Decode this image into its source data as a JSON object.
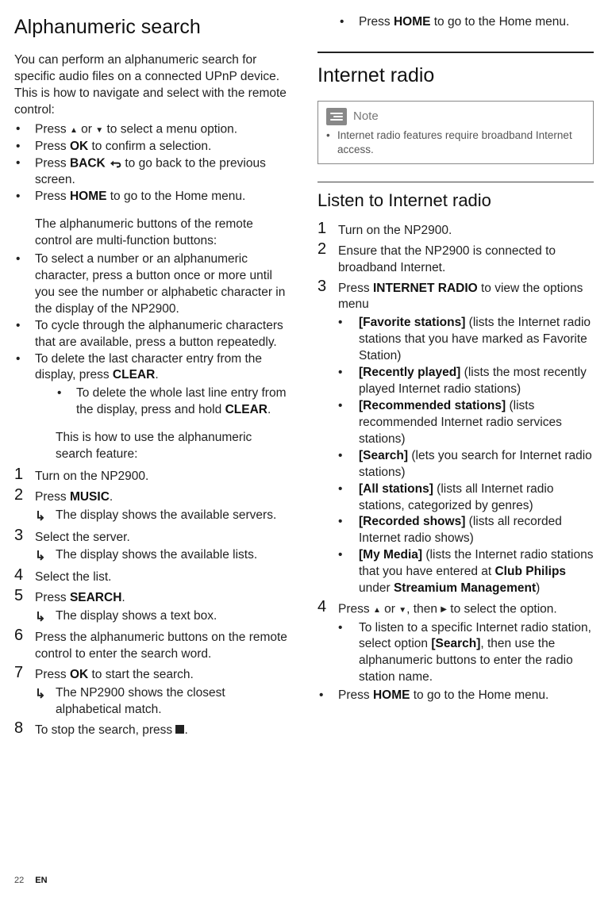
{
  "left": {
    "title": "Alphanumeric search",
    "intro": "You can perform an alphanumeric search for specific audio files on a connected UPnP device. This is how to navigate and select with the remote control:",
    "bullets1": [
      {
        "pre": "Press ",
        "mid1": "",
        "or": " or ",
        "mid2": "",
        "post": " to select a menu option.",
        "hasArrows": true
      },
      {
        "pre": "Press ",
        "bold": "OK",
        "post": " to confirm a selection."
      },
      {
        "pre": "Press ",
        "bold": "BACK",
        "post": " to go back to the previous screen.",
        "hasBackIcon": true
      },
      {
        "pre": "Press ",
        "bold": "HOME",
        "post": " to go to the Home menu."
      }
    ],
    "midPara": "The alphanumeric buttons of the remote control are multi-function buttons:",
    "bullets2": [
      {
        "text": "To select a number or an alphanumeric character, press a button once or more until you see the number or alphabetic character in the display of the NP2900."
      },
      {
        "text": "To cycle through the alphanumeric characters that are available, press a button repeatedly."
      },
      {
        "pre": "To delete the last character entry from the display, press ",
        "bold": "CLEAR",
        "post": ".",
        "sub": [
          {
            "pre": "To delete the whole last line entry from the display, press and hold ",
            "bold": "CLEAR",
            "post": "."
          }
        ]
      }
    ],
    "midPara2": "This is how to use the alphanumeric search feature:",
    "steps": [
      {
        "n": "1",
        "text": "Turn on the NP2900."
      },
      {
        "n": "2",
        "pre": "Press ",
        "bold": "MUSIC",
        "post": ".",
        "result": "The display shows the available servers."
      },
      {
        "n": "3",
        "text": "Select the server.",
        "result": "The display shows the available lists."
      },
      {
        "n": "4",
        "text": "Select the list."
      },
      {
        "n": "5",
        "pre": "Press ",
        "bold": "SEARCH",
        "post": ".",
        "result": "The display shows a text box."
      },
      {
        "n": "6",
        "text": "Press the alphanumeric buttons on the remote control to enter the search word."
      },
      {
        "n": "7",
        "pre": "Press ",
        "bold": "OK",
        "post": " to start the search.",
        "result": "The NP2900 shows the closest alphabetical match."
      },
      {
        "n": "8",
        "pre": "To stop the search, press ",
        "stopIcon": true,
        "post": "."
      }
    ]
  },
  "right": {
    "topBullet": {
      "pre": "Press ",
      "bold": "HOME",
      "post": " to go to the Home menu."
    },
    "title": "Internet radio",
    "noteLabel": "Note",
    "noteText": "Internet radio features require broadband Internet access.",
    "sub": {
      "title": "Listen to Internet radio",
      "steps": [
        {
          "n": "1",
          "text": "Turn on the NP2900."
        },
        {
          "n": "2",
          "text": "Ensure that the NP2900 is connected to broadband Internet."
        },
        {
          "n": "3",
          "pre": "Press ",
          "bold": "INTERNET RADIO",
          "post": " to view the options menu",
          "options": [
            {
              "label": "[Favorite stations]",
              "desc": " (lists the Internet radio stations that you have marked as Favorite Station)"
            },
            {
              "label": "[Recently played]",
              "desc": " (lists the most recently played Internet radio stations)"
            },
            {
              "label": "[Recommended stations]",
              "desc": " (lists recommended Internet radio services stations)"
            },
            {
              "label": "[Search]",
              "desc": " (lets you search for Internet radio stations)"
            },
            {
              "label": "[All stations]",
              "desc": " (lists all Internet radio stations, categorized by genres)"
            },
            {
              "label": "[Recorded shows]",
              "desc": " (lists all recorded Internet radio shows)"
            },
            {
              "label": "[My Media]",
              "descPre": " (lists the Internet radio stations that you have entered at ",
              "bold1": "Club Philips",
              "mid": " under ",
              "bold2": "Streamium Management",
              "descPost": ")"
            }
          ]
        },
        {
          "n": "4",
          "pre": "Press ",
          "arrows": true,
          "mid": ", then ",
          "arrowRight": true,
          "post": " to select the option.",
          "subBullets": [
            {
              "pre": "To listen to a specific Internet radio station, select option ",
              "bold": "[Search]",
              "post": ", then use the alphanumeric buttons to enter the radio station name."
            }
          ]
        }
      ],
      "tailBullet": {
        "pre": "Press ",
        "bold": "HOME",
        "post": " to go to the Home menu."
      }
    }
  },
  "footer": {
    "page": "22",
    "lang": "EN"
  }
}
